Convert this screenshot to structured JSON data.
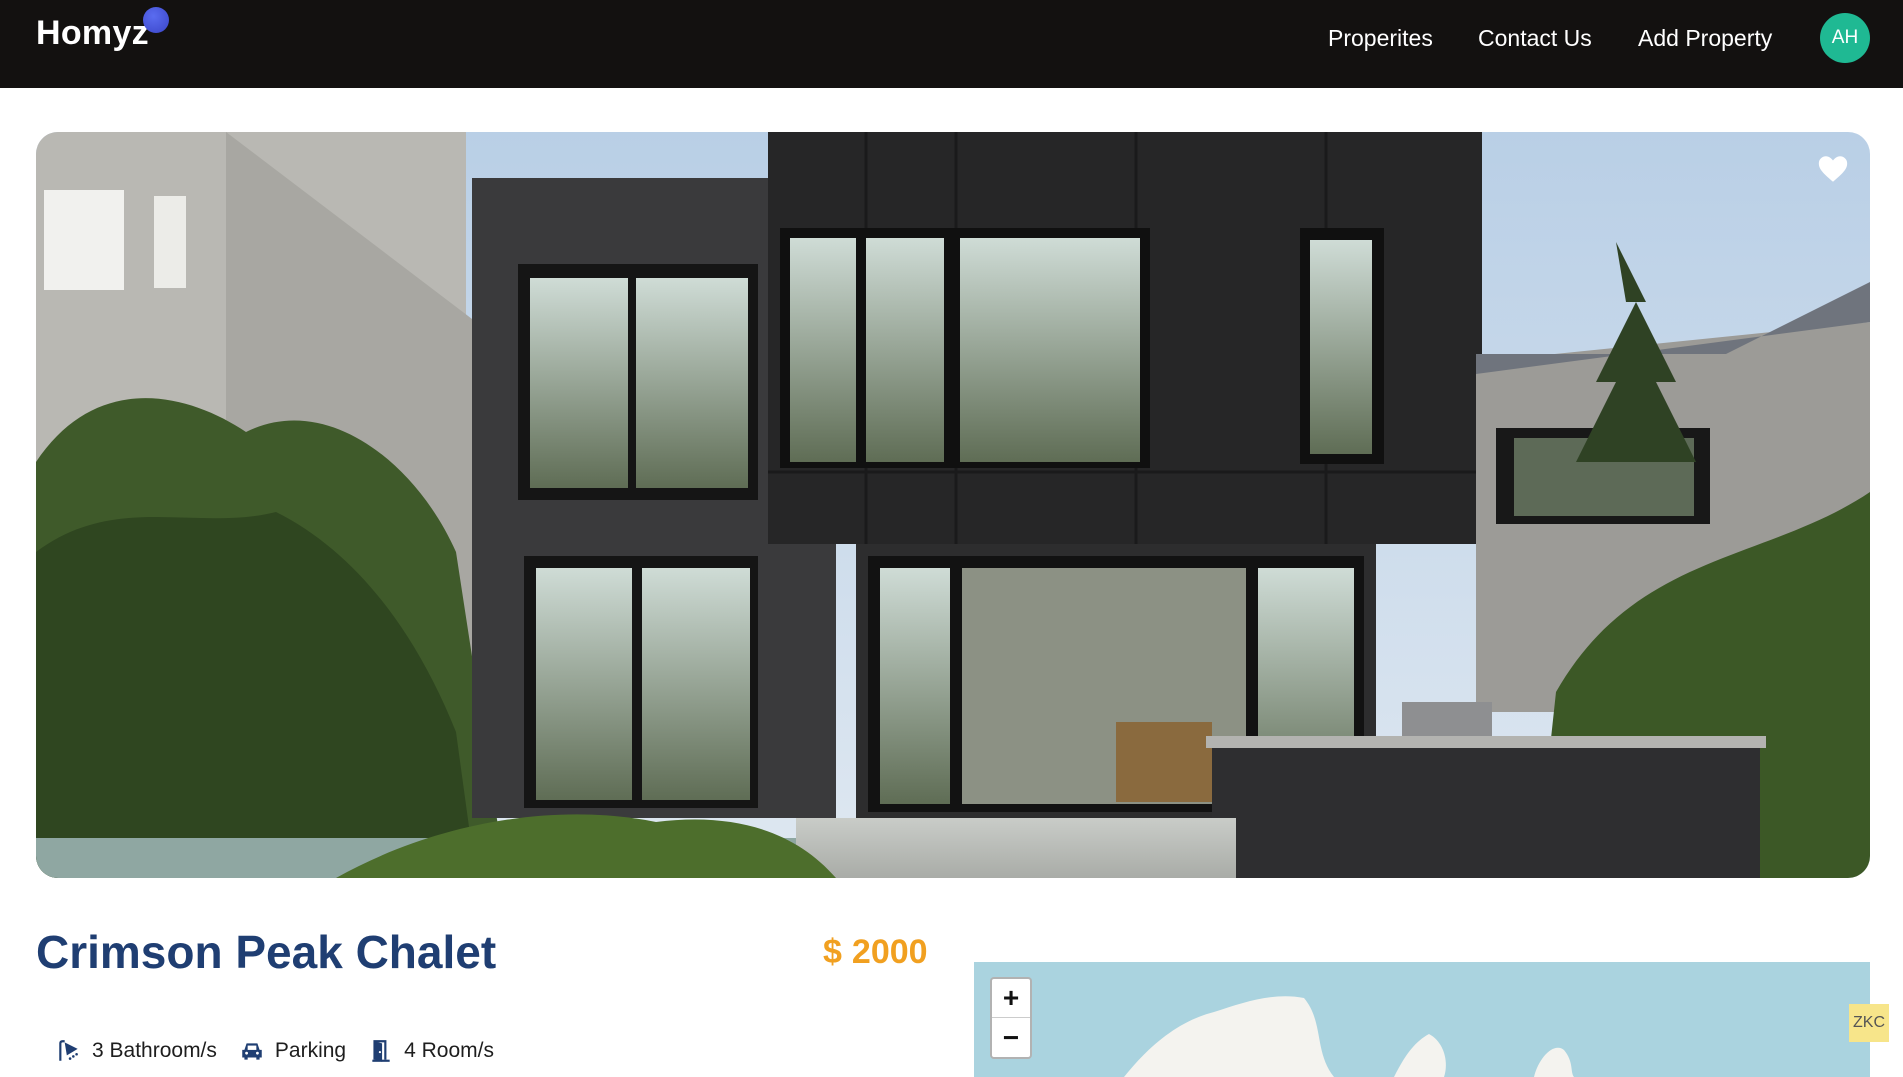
{
  "header": {
    "logo": "Homyz",
    "nav": [
      "Properites",
      "Contact Us",
      "Add Property"
    ],
    "avatar_initials": "AH"
  },
  "property": {
    "title": "Crimson Peak Chalet",
    "price_symbol": "$",
    "price": "2000",
    "facilities": [
      {
        "icon": "shower-icon",
        "label": "3 Bathroom/s"
      },
      {
        "icon": "car-icon",
        "label": "Parking"
      },
      {
        "icon": "door-icon",
        "label": "4 Room/s"
      }
    ]
  },
  "map": {
    "zoom_in": "+",
    "zoom_out": "−",
    "tag": "ZKC"
  },
  "colors": {
    "header_bg": "#131110",
    "title": "#1f3e72",
    "price": "#f1a020",
    "avatar": "#1fb993",
    "map_water": "#aad3df"
  }
}
